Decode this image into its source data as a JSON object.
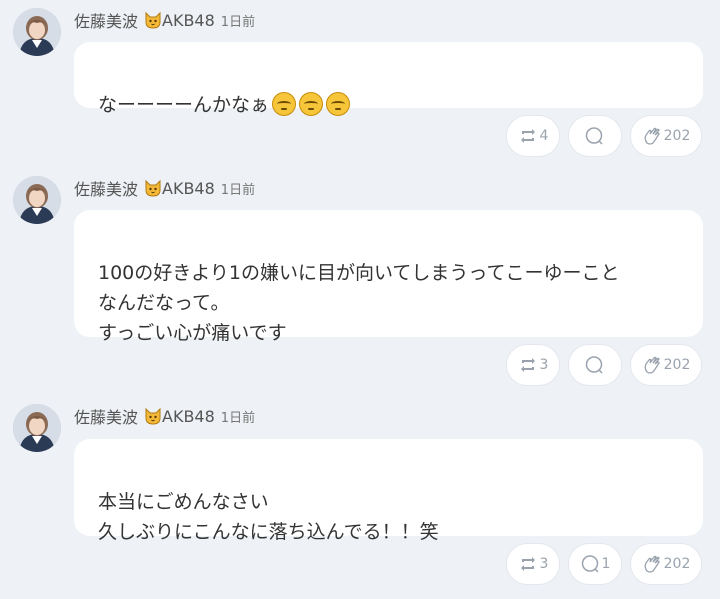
{
  "posts": [
    {
      "author": "佐藤美波",
      "group": "AKB48",
      "time": "1日前",
      "text": "なーーーーんかなぁ",
      "emojis": [
        "pensive-face",
        "pensive-face",
        "pensive-face"
      ],
      "retweets": "4",
      "comments": "",
      "claps": "202"
    },
    {
      "author": "佐藤美波",
      "group": "AKB48",
      "time": "1日前",
      "text": "100の好きより1の嫌いに目が向いてしまうってこーゆーこと\nなんだなって。\nすっごい心が痛いです",
      "emojis": [],
      "retweets": "3",
      "comments": "",
      "claps": "202"
    },
    {
      "author": "佐藤美波",
      "group": "AKB48",
      "time": "1日前",
      "text": "本当にごめんなさい\n久しぶりにこんなに落ち込んでる！！笑",
      "emojis": [],
      "retweets": "3",
      "comments": "1",
      "claps": "202"
    }
  ],
  "icons": {
    "badge": "cat-face-icon",
    "retweet": "retweet-icon",
    "comment": "comment-icon",
    "clap": "clap-icon"
  },
  "colors": {
    "background": "#eef1f5",
    "bubble": "#ffffff",
    "icon_gray": "#9aa3ad"
  }
}
